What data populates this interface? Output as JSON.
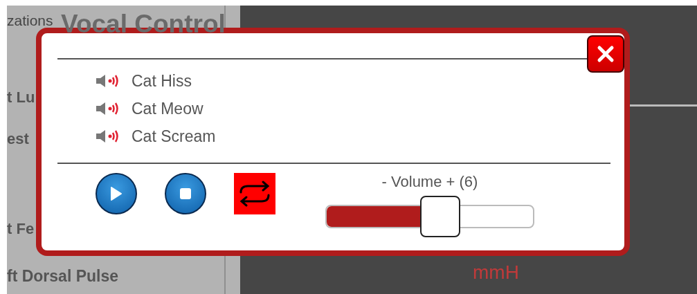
{
  "background": {
    "left_panel": {
      "heading_fragment": "zations",
      "lines": [
        "t Lu",
        "est",
        "t Fe",
        "ft Dorsal Pulse"
      ]
    },
    "vitals": {
      "pressure_unit": "mmH"
    }
  },
  "dialog": {
    "title": "Vocal Control",
    "sounds": [
      {
        "label": "Cat Hiss"
      },
      {
        "label": "Cat Meow"
      },
      {
        "label": "Cat Scream"
      }
    ],
    "repeat": {
      "on": true
    },
    "volume": {
      "label": "- Volume + (6)",
      "level": 0.55
    }
  }
}
